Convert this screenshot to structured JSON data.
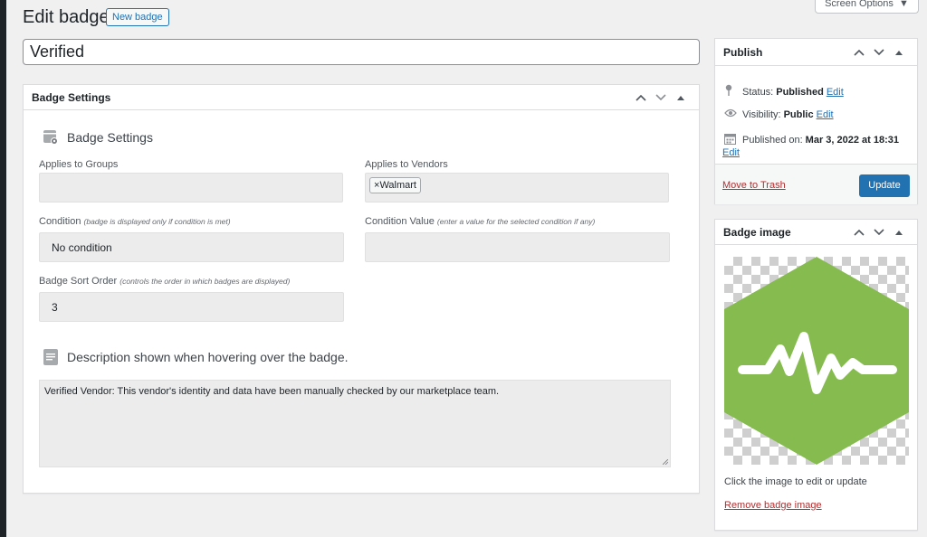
{
  "header": {
    "title": "Edit badge",
    "new_button": "New badge",
    "screen_options": "Screen Options"
  },
  "post_title": "Verified",
  "badge_settings": {
    "box_title": "Badge Settings",
    "section_title": "Badge Settings",
    "applies_groups_label": "Applies to Groups",
    "applies_groups_value": "",
    "applies_vendors_label": "Applies to Vendors",
    "vendor_tags": [
      "Walmart"
    ],
    "condition_label": "Condition",
    "condition_note": "(badge is displayed only if condition is met)",
    "condition_value": "No condition",
    "condition_value_label": "Condition Value",
    "condition_value_note": "(enter a value for the selected condition if any)",
    "condition_value_value": "",
    "sort_label": "Badge Sort Order",
    "sort_note": "(controls the order in which badges are displayed)",
    "sort_value": "3",
    "description_title": "Description shown when hovering over the badge.",
    "description_value": "Verified Vendor: This vendor's identity and data have been manually checked by our marketplace team."
  },
  "publish": {
    "title": "Publish",
    "status_label": "Status:",
    "status_value": "Published",
    "visibility_label": "Visibility:",
    "visibility_value": "Public",
    "published_label": "Published on:",
    "published_value": "Mar 3, 2022 at 18:31",
    "edit_link": "Edit",
    "trash_link": "Move to Trash",
    "update_button": "Update"
  },
  "badge_image": {
    "title": "Badge image",
    "caption": "Click the image to edit or update",
    "remove_link": "Remove badge image",
    "badge_color": "#85bb4f"
  },
  "colors": {
    "accent": "#2271b1",
    "danger": "#b32d2e"
  }
}
